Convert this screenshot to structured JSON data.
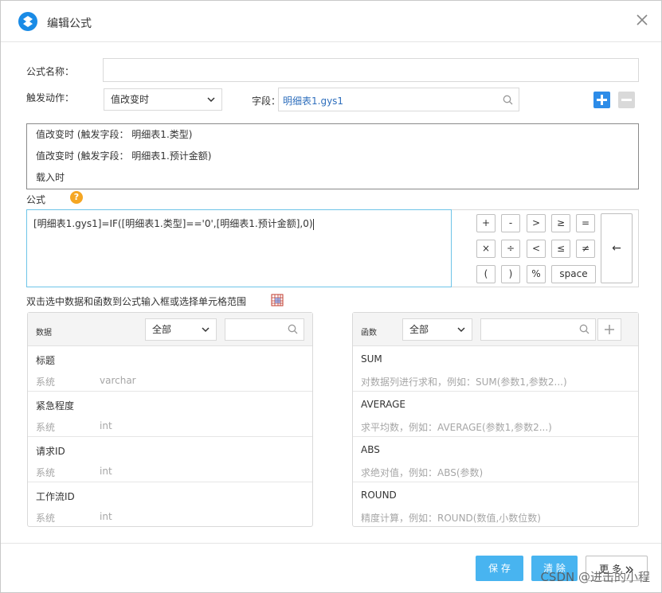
{
  "dialog": {
    "title": "编辑公式",
    "accent": "#1a8be6"
  },
  "form": {
    "name_label": "公式名称：",
    "name_value": "",
    "trigger_label": "触发动作：",
    "trigger_value": "值改变时",
    "field_label": "字段：",
    "field_value": "明细表1.gys1"
  },
  "triggers": [
    "值改变时 (触发字段： 明细表1.类型)",
    "值改变时 (触发字段： 明细表1.预计金额)",
    "载入时"
  ],
  "formula": {
    "label": "公式",
    "help": "?",
    "expression": "[明细表1.gys1]=IF([明细表1.类型]=='0',[明细表1.预计金额],0)"
  },
  "operators": {
    "row1": [
      "+",
      "-",
      ">",
      "≥",
      "="
    ],
    "row2": [
      "×",
      "÷",
      "<",
      "≤",
      "≠"
    ],
    "row3": [
      "(",
      ")",
      "%",
      "space"
    ],
    "backspace": "←"
  },
  "hint": "双击选中数据和函数到公式输入框或选择单元格范围",
  "data_panel": {
    "title": "数据",
    "filter": "全部",
    "items": [
      {
        "name": "标题",
        "source": "系统",
        "type": "varchar"
      },
      {
        "name": "紧急程度",
        "source": "系统",
        "type": "int"
      },
      {
        "name": "请求ID",
        "source": "系统",
        "type": "int"
      },
      {
        "name": "工作流ID",
        "source": "系统",
        "type": "int"
      }
    ]
  },
  "func_panel": {
    "title": "函数",
    "filter": "全部",
    "items": [
      {
        "name": "SUM",
        "desc": "对数据列进行求和，例如：SUM(参数1,参数2...)"
      },
      {
        "name": "AVERAGE",
        "desc": "求平均数，例如：AVERAGE(参数1,参数2...)"
      },
      {
        "name": "ABS",
        "desc": "求绝对值，例如：ABS(参数)"
      },
      {
        "name": "ROUND",
        "desc": "精度计算，例如：ROUND(数值,小数位数)"
      }
    ]
  },
  "footer": {
    "save": "保 存",
    "clear": "清 除",
    "more": "更 多",
    "watermark": "CSDN @进击的小程"
  }
}
